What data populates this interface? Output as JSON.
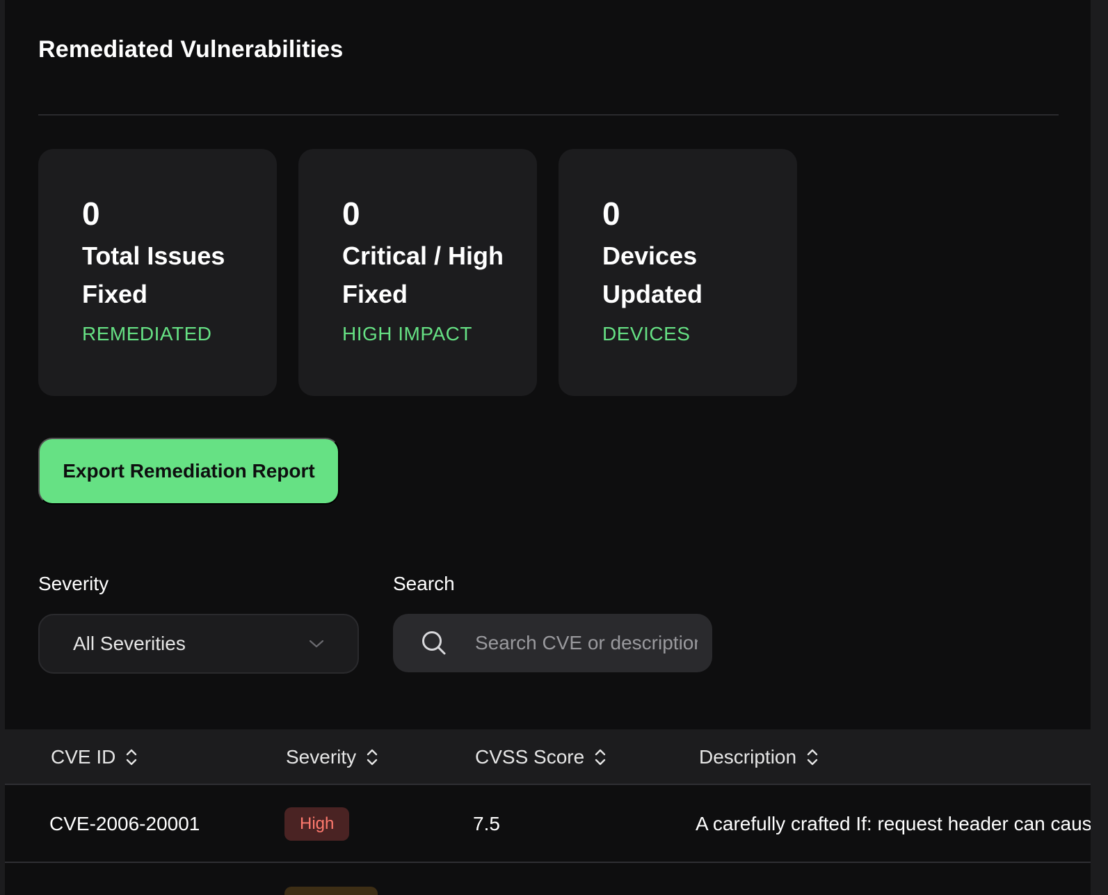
{
  "page": {
    "title": "Remediated Vulnerabilities"
  },
  "summary_cards": [
    {
      "value": "0",
      "label": "Total Issues Fixed",
      "tag": "REMEDIATED"
    },
    {
      "value": "0",
      "label": "Critical / High Fixed",
      "tag": "HIGH IMPACT"
    },
    {
      "value": "0",
      "label": "Devices Updated",
      "tag": "DEVICES"
    }
  ],
  "actions": {
    "export_label": "Export Remediation Report"
  },
  "filters": {
    "severity_label": "Severity",
    "severity_value": "All Severities",
    "search_label": "Search",
    "search_placeholder": "Search CVE or description"
  },
  "table": {
    "columns": [
      "CVE ID",
      "Severity",
      "CVSS Score",
      "Description"
    ],
    "rows": [
      {
        "cve_id": "CVE-2006-20001",
        "severity": "High",
        "cvss": "7.5",
        "description": "A carefully crafted If: request header can cause"
      }
    ]
  },
  "colors": {
    "accent": "#66e184",
    "background": "#0e0e0f",
    "card": "#1c1c1e",
    "high_badge_bg": "#4a2323",
    "high_badge_text": "#ff7a6e"
  },
  "icons": [
    "search-icon",
    "chevron-down-icon",
    "sort-icon"
  ]
}
